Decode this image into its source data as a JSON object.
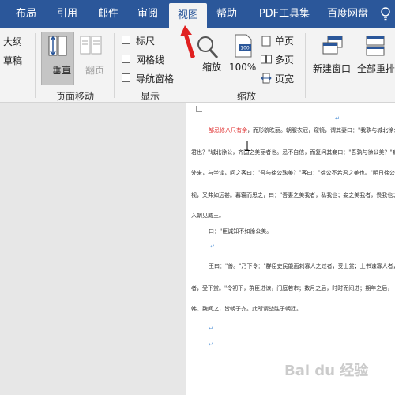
{
  "tabs": [
    {
      "label": "布局"
    },
    {
      "label": "引用"
    },
    {
      "label": "邮件"
    },
    {
      "label": "审阅"
    },
    {
      "label": "视图",
      "active": true
    },
    {
      "label": "帮助"
    },
    {
      "label": "PDF工具集"
    },
    {
      "label": "百度网盘"
    }
  ],
  "ribbon": {
    "views": {
      "outline": "大纲",
      "draft": "草稿"
    },
    "page_move": {
      "vertical": "垂直",
      "side": "翻页",
      "group_label": "页面移动"
    },
    "show": {
      "ruler": "标尺",
      "gridlines": "网格线",
      "nav_pane": "导航窗格",
      "group_label": "显示"
    },
    "zoom": {
      "zoom": "缩放",
      "percent": "100%",
      "one_page": "单页",
      "multi_page": "多页",
      "page_width": "页宽",
      "group_label": "缩放"
    },
    "window": {
      "new_window": "新建窗口",
      "arrange_all": "全部重排"
    }
  },
  "document": {
    "lines": [
      {
        "red": "邹忌修八尺有余",
        "rest": "，而形貌昳丽。朝服衣冠，窥镜，谓其妻曰：\"我孰与城北徐公"
      },
      {
        "text": "君也？\"城北徐公，齐国之美丽者也。忌不自信，而复问其妾曰：\"吾孰与徐公美？\"妾"
      },
      {
        "text": "外来，与坐谈，问之客曰：\"吾与徐公孰美？\"客曰：\"徐公不若君之美也。\"明日徐公来"
      },
      {
        "text": "视，又弗如远甚。暮寝而思之，曰：\"吾妻之美我者，私我也；妾之美我者，畏我也；"
      },
      {
        "text": "入朝见威王。"
      },
      {
        "text": "曰：\"臣诚知不如徐公美。"
      },
      {
        "text": "王曰：\"善。\"乃下令：\"群臣吏民能面刺寡人之过者，受上赏；上书谏寡人者，"
      },
      {
        "text": "者，受下赏。\"令初下，群臣进谏，门庭若市；数月之后，时时而间进；期年之后，"
      },
      {
        "text": "韩、魏闻之，皆朝于齐。此所谓战胜于朝廷。"
      }
    ]
  },
  "watermark": "Bai du 经验"
}
